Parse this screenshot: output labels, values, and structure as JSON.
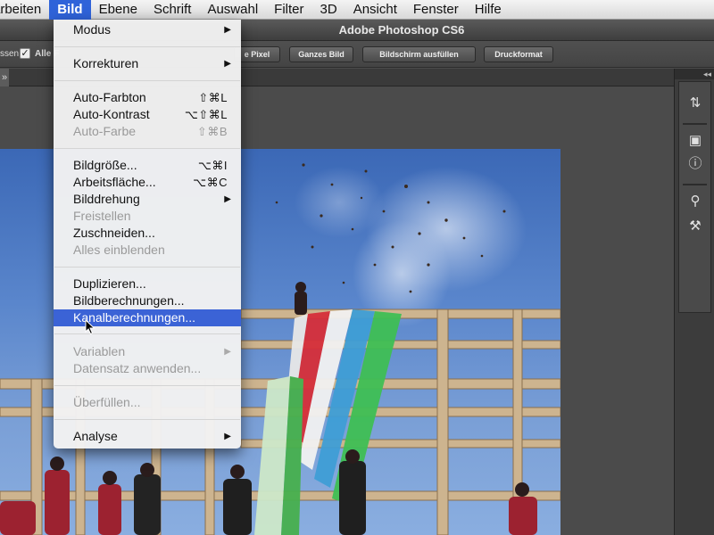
{
  "menubar": {
    "items": [
      "arbeiten",
      "Bild",
      "Ebene",
      "Schrift",
      "Auswahl",
      "Filter",
      "3D",
      "Ansicht",
      "Fenster",
      "Hilfe"
    ]
  },
  "window": {
    "title": "Adobe Photoshop CS6"
  },
  "options": {
    "partial_left": "ssen",
    "checkbox_label": "Alle F",
    "buttons": [
      "e Pixel",
      "Ganzes Bild",
      "Bildschirm ausfüllen",
      "Druckformat"
    ]
  },
  "tab": {
    "partial": "»"
  },
  "dock": {
    "collapse": "◂◂",
    "icons": [
      "history-icon",
      "3d-icon",
      "info-icon",
      "brush-presets-icon",
      "tool-presets-icon"
    ]
  },
  "menu": {
    "items": [
      {
        "label": "Modus",
        "submenu": true
      },
      {
        "label": "Korrekturen",
        "submenu": true
      },
      {
        "label": "Auto-Farbton",
        "shortcut": "⇧⌘L"
      },
      {
        "label": "Auto-Kontrast",
        "shortcut": "⌥⇧⌘L"
      },
      {
        "label": "Auto-Farbe",
        "shortcut": "⇧⌘B",
        "disabled": true
      },
      {
        "label": "Bildgröße...",
        "shortcut": "⌥⌘I"
      },
      {
        "label": "Arbeitsfläche...",
        "shortcut": "⌥⌘C"
      },
      {
        "label": "Bilddrehung",
        "submenu": true
      },
      {
        "label": "Freistellen",
        "disabled": true
      },
      {
        "label": "Zuschneiden..."
      },
      {
        "label": "Alles einblenden",
        "disabled": true
      },
      {
        "label": "Duplizieren..."
      },
      {
        "label": "Bildberechnungen..."
      },
      {
        "label": "Kanalberechnungen...",
        "highlighted": true
      },
      {
        "label": "Variablen",
        "submenu": true,
        "disabled": true
      },
      {
        "label": "Datensatz anwenden...",
        "disabled": true
      },
      {
        "label": "Überfüllen...",
        "disabled": true
      },
      {
        "label": "Analyse",
        "submenu": true
      }
    ]
  },
  "colors": {
    "highlight": "#3b63d6",
    "menubar_active": "#2f63d9",
    "disabled_text": "#9a9a9a"
  }
}
